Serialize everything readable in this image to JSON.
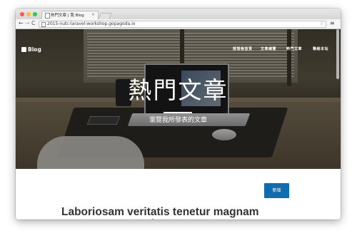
{
  "browser": {
    "tab_title": "熱門文章 | 我 Blog",
    "tab_close": "×",
    "url": "2015-nutc-laravel-workshop.gopagoda.io",
    "nav": {
      "back": "←",
      "forward": "→",
      "reload": "C"
    },
    "star": "☆",
    "menu": "≡"
  },
  "site": {
    "brand": "Blog",
    "nav_items": [
      "部落格首頁",
      "文章總覽",
      "熱門文章",
      "聯絡本站"
    ]
  },
  "hero": {
    "title": "熱門文章",
    "subtitle": "瀏覽我所發表的文章"
  },
  "main": {
    "new_button": "新增",
    "post_title": "Laboriosam veritatis tenetur magnam est saepe non soluta."
  }
}
